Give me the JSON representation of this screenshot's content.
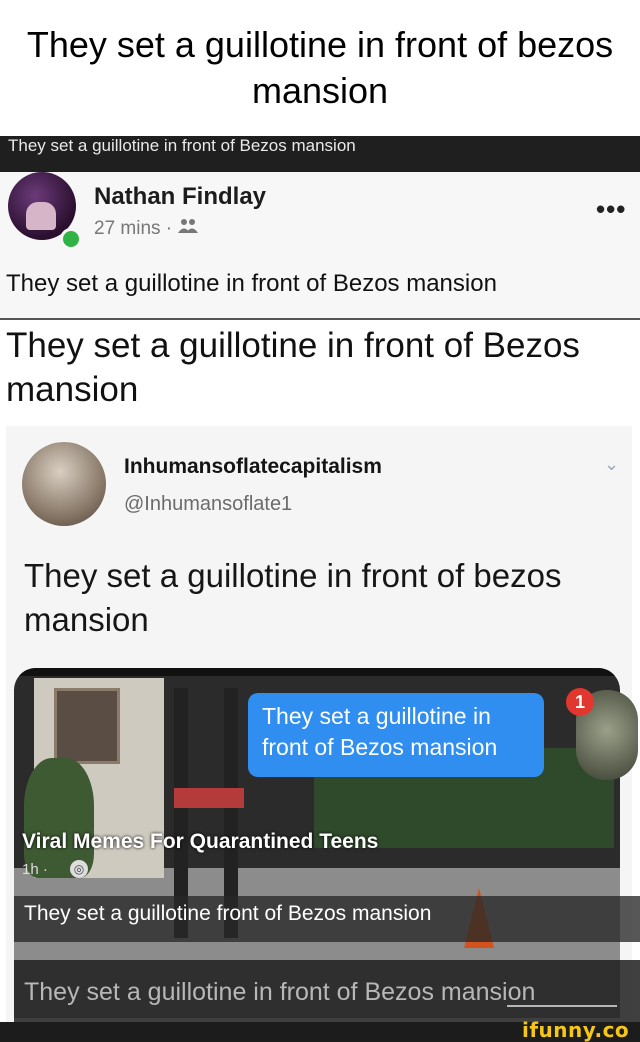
{
  "meme_title": "They set a guillotine in front of bezos mansion",
  "screenshot_header": "They set a guillotine in front of Bezos mansion",
  "fb_post": {
    "author": "Nathan Findlay",
    "time": "27 mins ·",
    "audience_icon": "people-icon",
    "more_label": "•••",
    "text": "They set a guillotine in front of Bezos mansion"
  },
  "big_caption": "They set a guillotine in front of Bezos mansion",
  "tweet": {
    "name": "Inhumansoflatecapitalism",
    "handle": "@Inhumansoflate1",
    "chevron": "⌄",
    "text": "They set a guillotine in front of bezos mansion"
  },
  "chat_bubble": {
    "text": "They set a guillotine in front of Bezos mansion",
    "badge": "1"
  },
  "group_post": {
    "name": "Viral Memes For Quarantined Teens",
    "time": "1h ·",
    "caption": "They set a guillotine front of Bezos mansion"
  },
  "bottom_caption": "They set a guillotine in front of Bezos mansion",
  "watermark": "ifunny.co"
}
